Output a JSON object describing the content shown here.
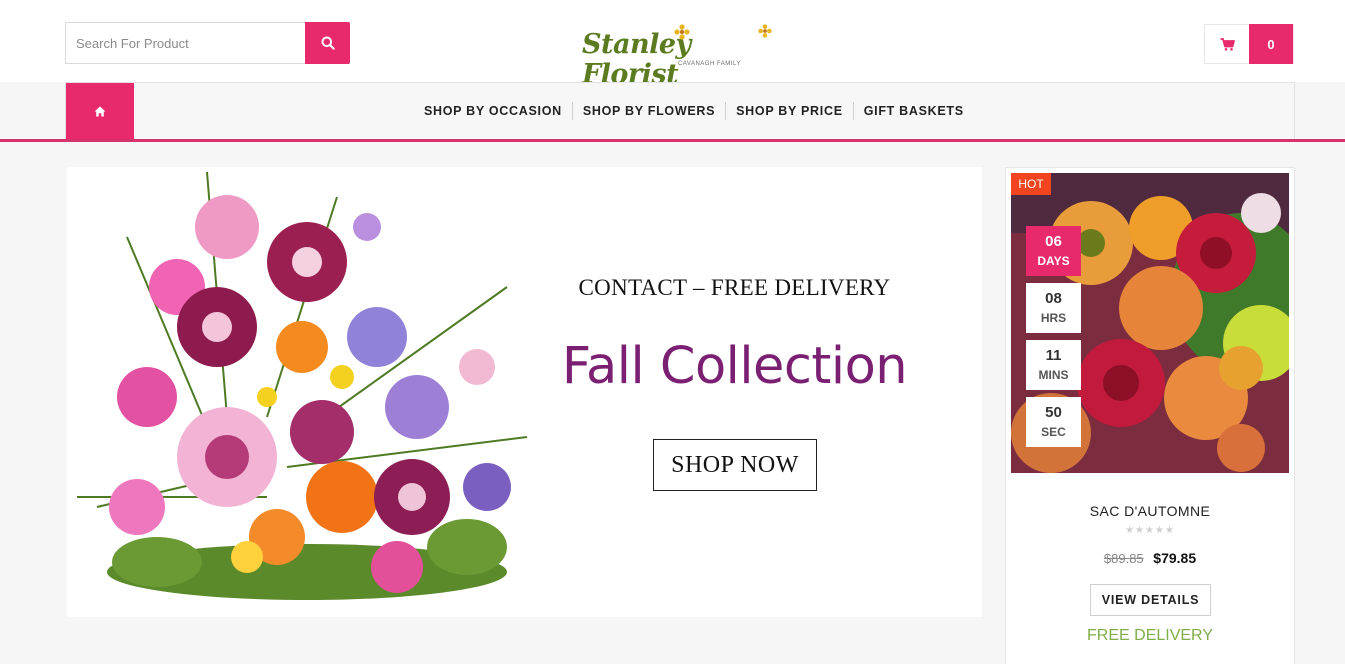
{
  "header": {
    "search": {
      "placeholder": "Search For Product"
    },
    "logo": {
      "text": "Stanley Florist",
      "tagline": "CAVANAGH FAMILY"
    },
    "cart": {
      "count": "0"
    }
  },
  "nav": {
    "items": [
      {
        "label": "SHOP BY OCCASION"
      },
      {
        "label": "SHOP BY FLOWERS"
      },
      {
        "label": "SHOP BY PRICE"
      },
      {
        "label": "GIFT BASKETS"
      }
    ]
  },
  "hero": {
    "kicker": "CONTACT – FREE DELIVERY",
    "title": "Fall Collection",
    "cta": "SHOP NOW"
  },
  "product": {
    "badge": "HOT",
    "countdown": [
      {
        "value": "06",
        "unit": "DAYS"
      },
      {
        "value": "08",
        "unit": "HRS"
      },
      {
        "value": "11",
        "unit": "MINS"
      },
      {
        "value": "50",
        "unit": "SEC"
      }
    ],
    "name": "SAC D'AUTOMNE",
    "rating": 0,
    "old_price": "$89.85",
    "price": "$79.85",
    "view_label": "VIEW DETAILS",
    "delivery": "FREE DELIVERY"
  },
  "colors": {
    "accent": "#e8296b",
    "hot": "#f2451f",
    "hero_title": "#7a1f72",
    "delivery": "#7fae4a"
  }
}
